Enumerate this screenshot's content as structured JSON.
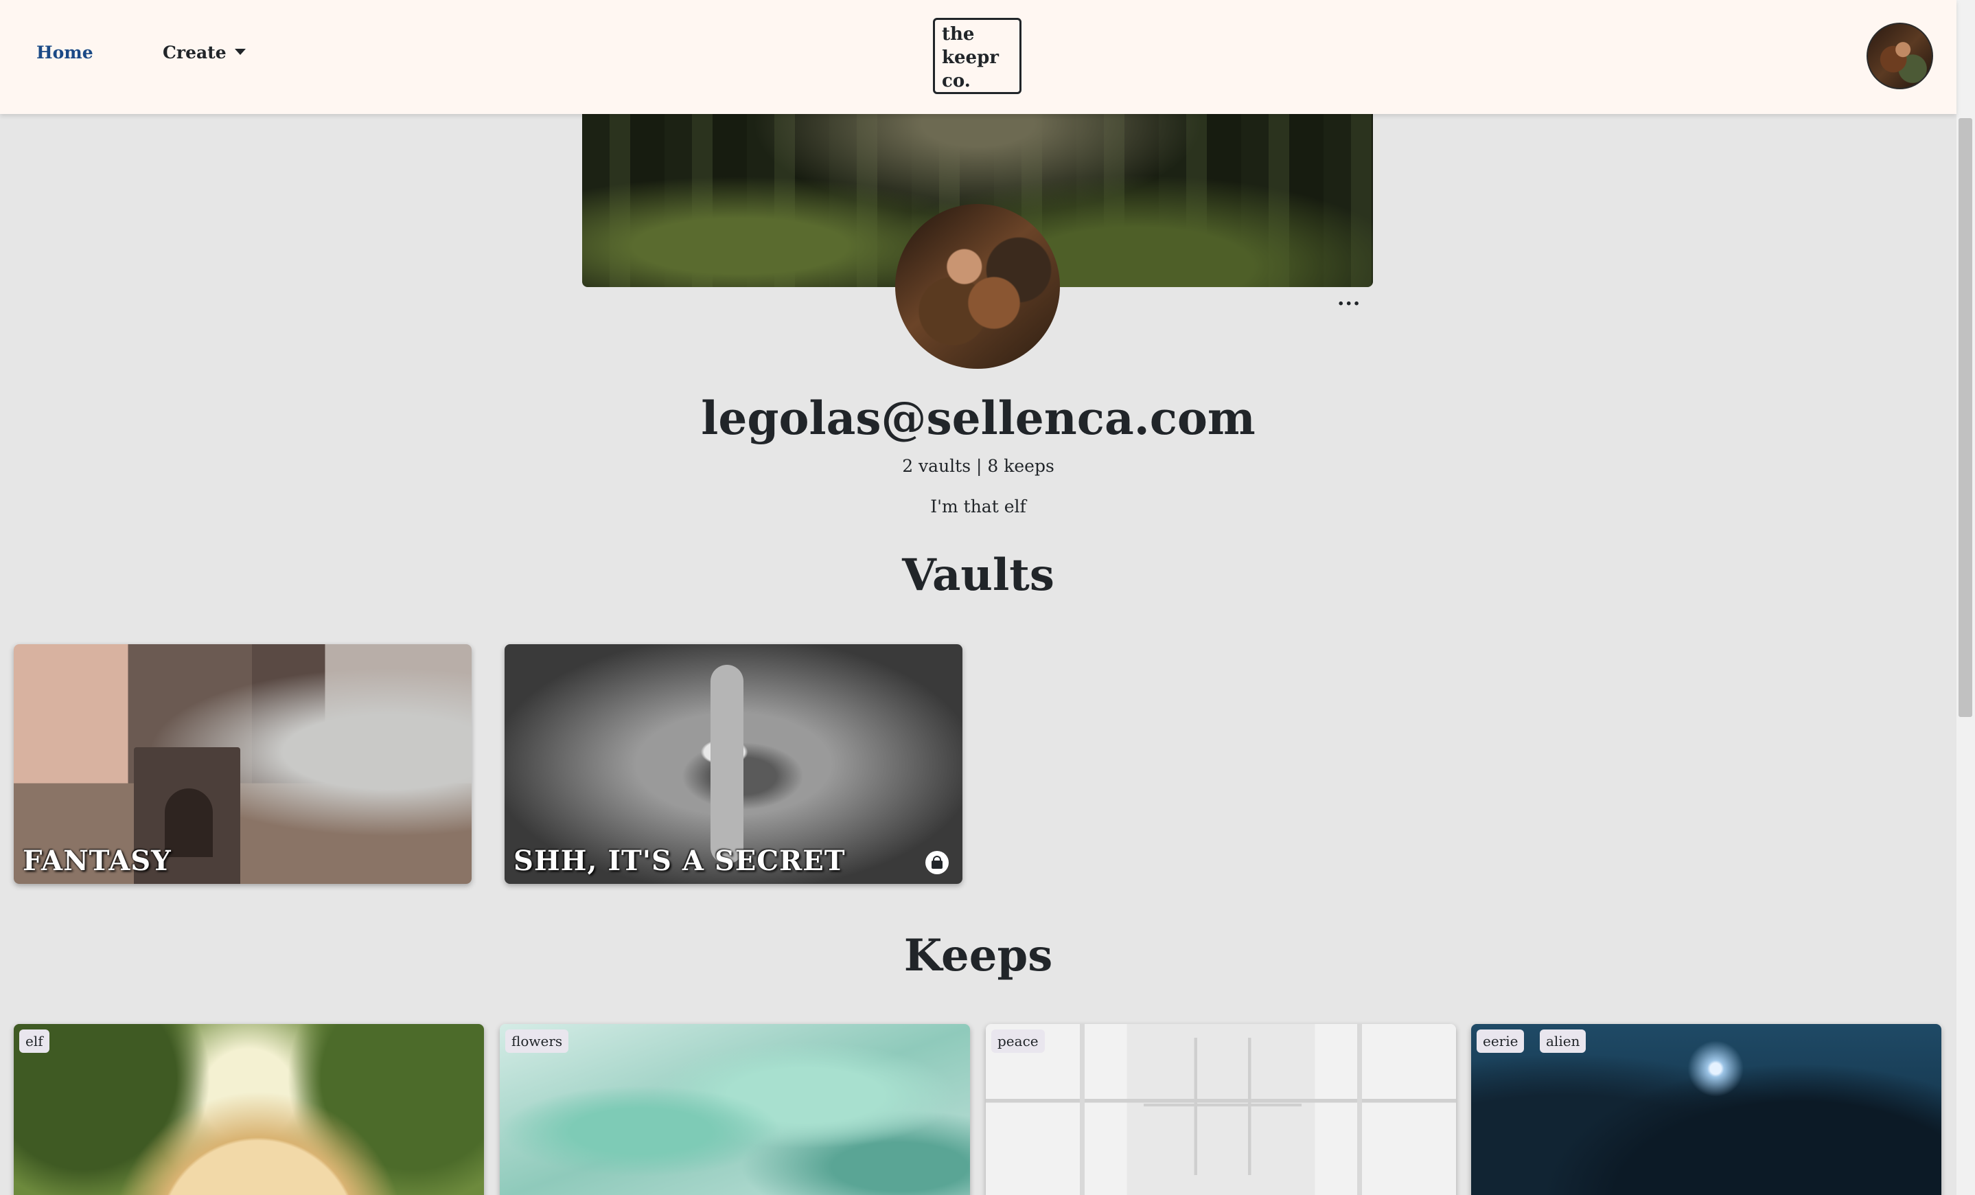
{
  "nav": {
    "home_label": "Home",
    "create_label": "Create",
    "logo_text": "the keepr co."
  },
  "profile": {
    "name": "legolas@sellenca.com",
    "stats": "2 vaults | 8 keeps",
    "bio": "I'm that elf",
    "more_label": "..."
  },
  "vaults": {
    "title": "Vaults",
    "items": [
      {
        "label": "FANTASY",
        "private": false
      },
      {
        "label": "SHH, IT'S A SECRET",
        "private": true
      }
    ]
  },
  "keeps": {
    "title": "Keeps",
    "items": [
      {
        "tags": [
          "elf"
        ]
      },
      {
        "tags": [
          "flowers"
        ]
      },
      {
        "tags": [
          "peace"
        ]
      },
      {
        "tags": [
          "eerie",
          "alien"
        ]
      }
    ]
  },
  "colors": {
    "navbar_bg": "#fff7f2",
    "page_bg": "#e6e6e6",
    "link_accent": "#1b4a86",
    "text": "#212529"
  },
  "icons": {
    "lock": "lock-icon",
    "more": "more-icon",
    "caret": "chevron-down-icon"
  }
}
